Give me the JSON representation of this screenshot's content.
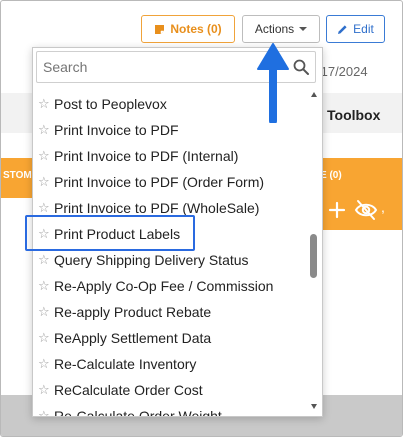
{
  "header": {
    "notes_label": "Notes (0)",
    "actions_label": "Actions",
    "edit_label": "Edit"
  },
  "date_fragment": "/17/2024",
  "toolbox_label": "Toolbox",
  "orange_left_text": "STOM",
  "orange_right_text": "E (0)",
  "search": {
    "placeholder": "Search"
  },
  "actions_menu": {
    "items": [
      "Post to Peoplevox",
      "Print Invoice to PDF",
      "Print Invoice to PDF (Internal)",
      "Print Invoice to PDF (Order Form)",
      "Print Invoice to PDF (WholeSale)",
      "Print Product Labels",
      "Query Shipping Delivery Status",
      "Re-Apply Co-Op Fee / Commission",
      "Re-apply Product Rebate",
      "ReApply Settlement Data",
      "Re-Calculate Inventory",
      "ReCalculate Order Cost",
      "Re-Calculate Order Weight"
    ],
    "highlighted_item": "Print Product Labels",
    "scroll_position": 0.52
  },
  "icons": {
    "notes": "note-icon",
    "edit": "pencil-icon",
    "search": "search-icon",
    "star": "star-outline-icon",
    "plus": "plus-icon",
    "eye": "eye-off-icon",
    "arrow": "up-arrow-annotation-icon"
  },
  "colors": {
    "notes_accent": "#f0a33a",
    "edit_accent": "#2f6fcb",
    "highlight": "#2a6ae0",
    "arrow": "#1f6fe0",
    "orange_bar": "#f8a532"
  }
}
